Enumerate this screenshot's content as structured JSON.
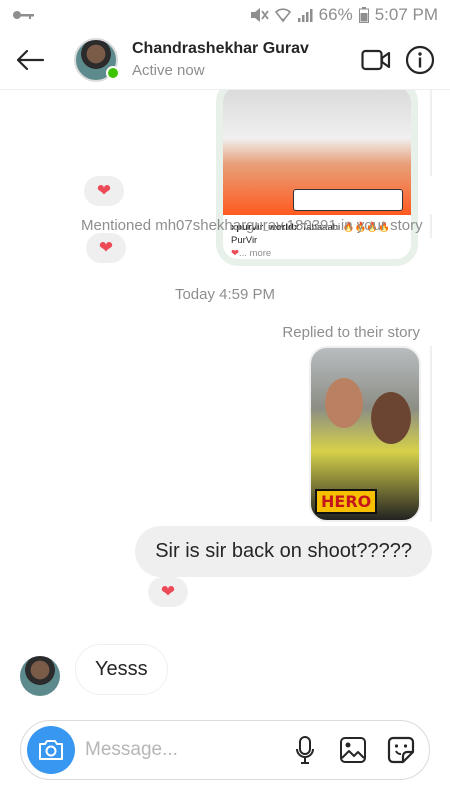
{
  "status_bar": {
    "battery": "66%",
    "time": "5:07 PM",
    "left_icon": "key-icon",
    "right_icons": [
      "mute-icon",
      "wifi-icon",
      "signal-icon",
      "battery-icon"
    ]
  },
  "header": {
    "back_icon": "arrow-left-icon",
    "name": "Chandrashekhar Gurav",
    "status": "Active now",
    "video_icon": "video-call-icon",
    "info_icon": "info-icon"
  },
  "shared_post": {
    "username": "xpurvir_worldx",
    "caption": "Tabaaahi 🔥🔥🔥🔥 PurVir",
    "more": "more"
  },
  "messages": {
    "mention_text": "Mentioned mh07shekhargurav.180391 in your story",
    "timestamp": "Today 4:59 PM",
    "replied_label": "Replied to their story",
    "story_badge": "HERO",
    "outgoing_text": "Sir is sir back on shoot?????",
    "incoming_text": "Yesss",
    "reaction": "❤"
  },
  "composer": {
    "placeholder": "Message...",
    "camera_icon": "camera-icon",
    "mic_icon": "microphone-icon",
    "gallery_icon": "gallery-icon",
    "sticker_icon": "sticker-icon"
  },
  "colors": {
    "accent": "#3897f0",
    "online": "#3ec300",
    "heart": "#ed4956",
    "bubble_gray": "#efefef",
    "meta_gray": "#8e8e8e"
  }
}
